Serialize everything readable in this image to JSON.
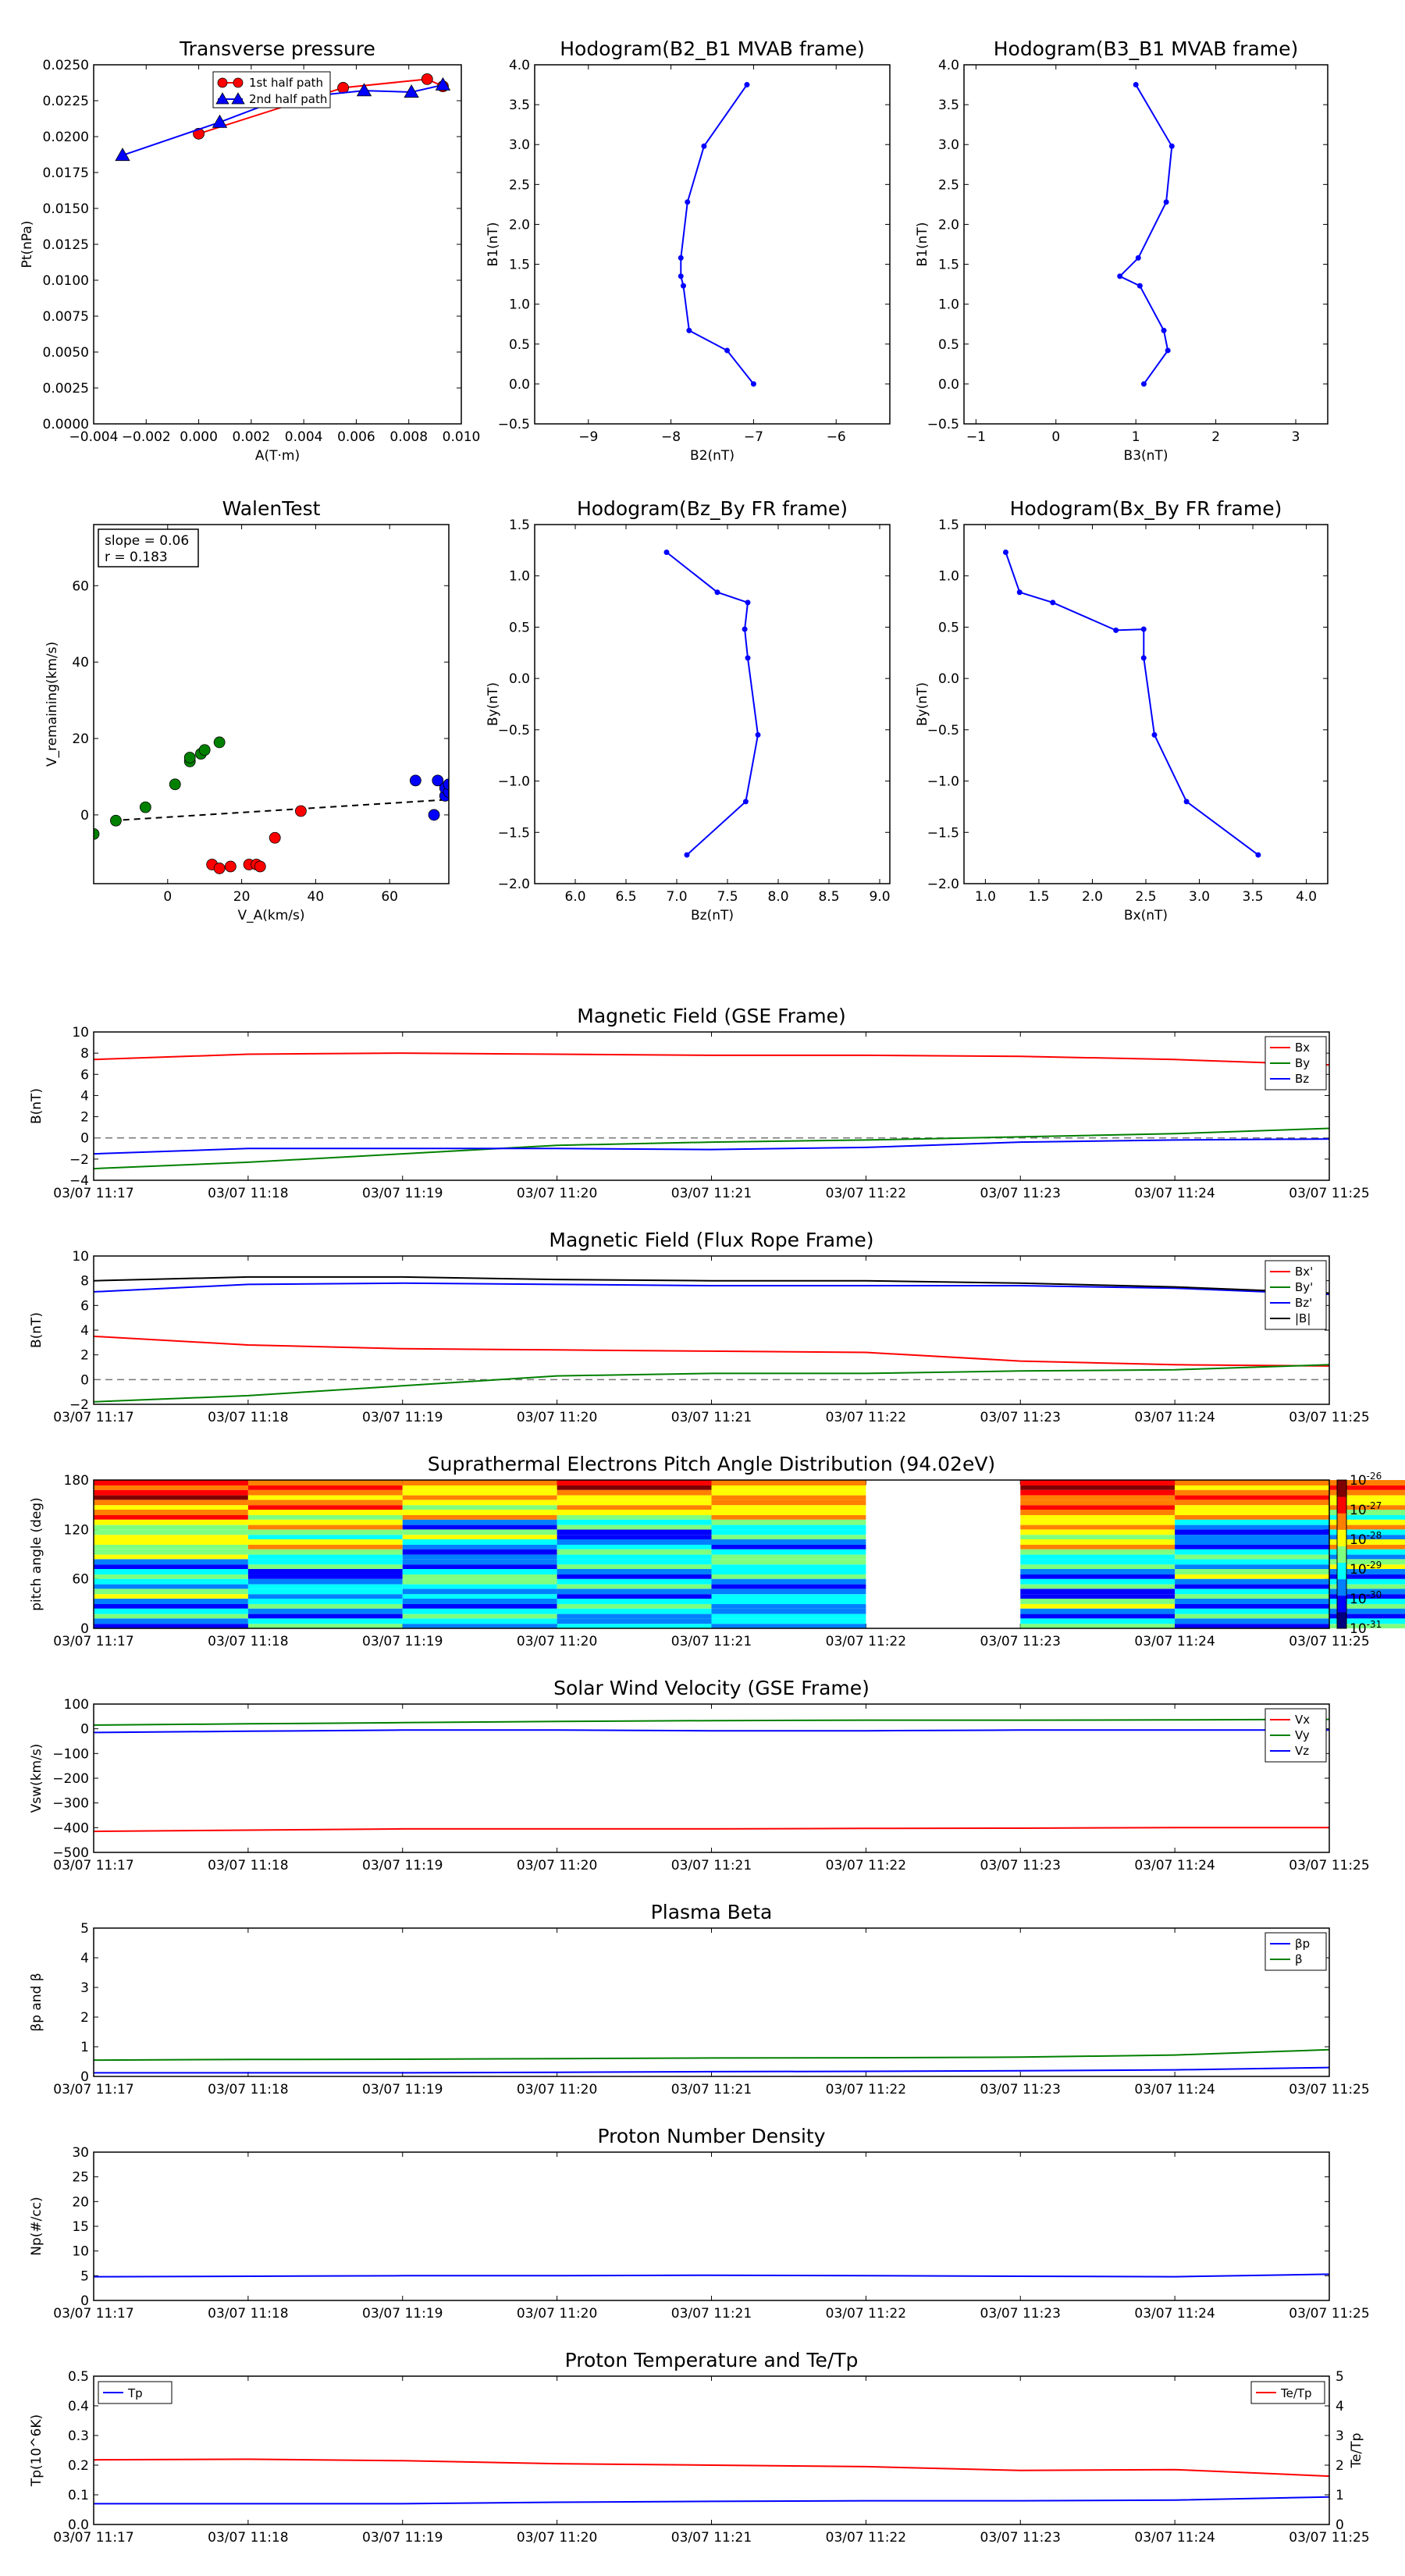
{
  "chart_data": [
    {
      "id": "transverse-pressure",
      "type": "line",
      "title": "Transverse pressure",
      "xlabel": "A(T·m)",
      "ylabel": "Pt(nPa)",
      "xlim": [
        -0.004,
        0.01
      ],
      "ylim": [
        0,
        0.025
      ],
      "xticks": [
        "−0.004",
        "−0.002",
        "0.000",
        "0.002",
        "0.004",
        "0.006",
        "0.008",
        "0.010"
      ],
      "yticks": [
        "0.0000",
        "0.0025",
        "0.0050",
        "0.0075",
        "0.0100",
        "0.0125",
        "0.0150",
        "0.0175",
        "0.0200",
        "0.0225",
        "0.0250"
      ],
      "legend": "top-center",
      "series": [
        {
          "name": "1st half path",
          "color": "#ff0000",
          "marker": "circle",
          "x": [
            0.0,
            0.0055,
            0.0087,
            0.0093
          ],
          "y": [
            0.0202,
            0.0234,
            0.024,
            0.0235
          ]
        },
        {
          "name": "2nd half path",
          "color": "#0000ff",
          "marker": "triangle",
          "x": [
            -0.0029,
            0.0008,
            0.0031,
            0.0063,
            0.0081,
            0.0093
          ],
          "y": [
            0.0187,
            0.021,
            0.0226,
            0.0232,
            0.0231,
            0.0236
          ]
        }
      ]
    },
    {
      "id": "hodogram-b2-b1",
      "type": "line",
      "title": "Hodogram(B2_B1 MVAB frame)",
      "xlabel": "B2(nT)",
      "ylabel": "B1(nT)",
      "xlim": [
        -9.65,
        -5.35
      ],
      "ylim": [
        -0.5,
        4.0
      ],
      "xticks": [
        "−9",
        "−8",
        "−7",
        "−6"
      ],
      "yticks": [
        "−0.5",
        "0.0",
        "0.5",
        "1.0",
        "1.5",
        "2.0",
        "2.5",
        "3.0",
        "3.5",
        "4.0"
      ],
      "series": [
        {
          "color": "#0000ff",
          "x": [
            -7.0,
            -7.32,
            -7.78,
            -7.85,
            -7.88,
            -7.88,
            -7.8,
            -7.6,
            -7.08
          ],
          "y": [
            0.0,
            0.42,
            0.67,
            1.23,
            1.35,
            1.58,
            2.28,
            2.98,
            3.75
          ]
        }
      ]
    },
    {
      "id": "hodogram-b3-b1",
      "type": "line",
      "title": "Hodogram(B3_B1 MVAB frame)",
      "xlabel": "B3(nT)",
      "ylabel": "B1(nT)",
      "xlim": [
        -1.15,
        3.4
      ],
      "ylim": [
        -0.5,
        4.0
      ],
      "xticks": [
        "−1",
        "0",
        "1",
        "2",
        "3"
      ],
      "yticks": [
        "−0.5",
        "0.0",
        "0.5",
        "1.0",
        "1.5",
        "2.0",
        "2.5",
        "3.0",
        "3.5",
        "4.0"
      ],
      "series": [
        {
          "color": "#0000ff",
          "x": [
            1.1,
            1.4,
            1.35,
            1.05,
            0.8,
            1.03,
            1.38,
            1.45,
            1.0
          ],
          "y": [
            0.0,
            0.42,
            0.67,
            1.23,
            1.35,
            1.58,
            2.28,
            2.98,
            3.75
          ]
        }
      ]
    },
    {
      "id": "walen-test",
      "type": "scatter",
      "title": "WalenTest",
      "xlabel": "V_A(km/s)",
      "ylabel": "V_remaining(km/s)",
      "xlim": [
        -20,
        76
      ],
      "ylim": [
        -18,
        76
      ],
      "xticks": [
        "0",
        "20",
        "40",
        "60"
      ],
      "yticks": [
        "0",
        "20",
        "40",
        "60"
      ],
      "annotation": [
        "slope = 0.06",
        "r = 0.183"
      ],
      "fit_line": {
        "x": [
          -15,
          76
        ],
        "y": [
          -1.5,
          4.0
        ],
        "color": "#000000"
      },
      "series": [
        {
          "color": "#008000",
          "x": [
            -20,
            -14,
            -6,
            2,
            6,
            6,
            9,
            10,
            14
          ],
          "y": [
            -5,
            -1.5,
            2,
            8,
            14,
            15,
            16,
            17,
            19
          ]
        },
        {
          "color": "#ff0000",
          "x": [
            12,
            14,
            17,
            22,
            24,
            25,
            29,
            36
          ],
          "y": [
            -13,
            -14,
            -13.5,
            -13,
            -13,
            -13.5,
            -6,
            1
          ]
        },
        {
          "color": "#0000ff",
          "x": [
            67,
            72,
            73,
            75,
            75,
            76,
            76
          ],
          "y": [
            9,
            0,
            9,
            5,
            7,
            6,
            8
          ]
        }
      ]
    },
    {
      "id": "hodogram-bz-by",
      "type": "line",
      "title": "Hodogram(Bz_By FR frame)",
      "xlabel": "Bz(nT)",
      "ylabel": "By(nT)",
      "xlim": [
        5.6,
        9.1
      ],
      "ylim": [
        -2.0,
        1.5
      ],
      "xticks": [
        "6.0",
        "6.5",
        "7.0",
        "7.5",
        "8.0",
        "8.5",
        "9.0"
      ],
      "yticks": [
        "−2.0",
        "−1.5",
        "−1.0",
        "−0.5",
        "0.0",
        "0.5",
        "1.0",
        "1.5"
      ],
      "series": [
        {
          "color": "#0000ff",
          "x": [
            7.1,
            7.68,
            7.8,
            7.7,
            7.67,
            7.7,
            7.4,
            6.9
          ],
          "y": [
            -1.72,
            -1.2,
            -0.55,
            0.2,
            0.48,
            0.74,
            0.84,
            1.23
          ]
        }
      ]
    },
    {
      "id": "hodogram-bx-by",
      "type": "line",
      "title": "Hodogram(Bx_By FR frame)",
      "xlabel": "Bx(nT)",
      "ylabel": "By(nT)",
      "xlim": [
        0.8,
        4.2
      ],
      "ylim": [
        -2.0,
        1.5
      ],
      "xticks": [
        "1.0",
        "1.5",
        "2.0",
        "2.5",
        "3.0",
        "3.5",
        "4.0"
      ],
      "yticks": [
        "−2.0",
        "−1.5",
        "−1.0",
        "−0.5",
        "0.0",
        "0.5",
        "1.0",
        "1.5"
      ],
      "series": [
        {
          "color": "#0000ff",
          "x": [
            3.55,
            2.88,
            2.58,
            2.48,
            2.48,
            2.22,
            1.63,
            1.32,
            1.19
          ],
          "y": [
            -1.72,
            -1.2,
            -0.55,
            0.2,
            0.48,
            0.47,
            0.74,
            0.84,
            1.23
          ]
        }
      ]
    },
    {
      "id": "magnetic-field-gse",
      "type": "line",
      "title": "Magnetic Field (GSE Frame)",
      "ylabel": "B(nT)",
      "x": [
        "03/07 11:17",
        "03/07 11:18",
        "03/07 11:19",
        "03/07 11:20",
        "03/07 11:21",
        "03/07 11:22",
        "03/07 11:23",
        "03/07 11:24",
        "03/07 11:25"
      ],
      "ylim": [
        -4,
        10
      ],
      "yticks": [
        "−4",
        "−2",
        "0",
        "2",
        "4",
        "6",
        "8",
        "10"
      ],
      "zero_line": true,
      "legend": "top-right",
      "series": [
        {
          "name": "Bx",
          "color": "#ff0000",
          "values": [
            7.4,
            7.9,
            8.0,
            7.9,
            7.8,
            7.8,
            7.7,
            7.4,
            6.9
          ]
        },
        {
          "name": "By",
          "color": "#008000",
          "values": [
            -2.9,
            -2.3,
            -1.5,
            -0.7,
            -0.4,
            -0.2,
            0.1,
            0.4,
            0.9
          ]
        },
        {
          "name": "Bz",
          "color": "#0000ff",
          "values": [
            -1.5,
            -1.0,
            -1.0,
            -1.0,
            -1.1,
            -0.9,
            -0.4,
            -0.2,
            -0.1
          ]
        }
      ]
    },
    {
      "id": "magnetic-field-flux-rope",
      "type": "line",
      "title": "Magnetic Field (Flux Rope Frame)",
      "ylabel": "B(nT)",
      "x": [
        "03/07 11:17",
        "03/07 11:18",
        "03/07 11:19",
        "03/07 11:20",
        "03/07 11:21",
        "03/07 11:22",
        "03/07 11:23",
        "03/07 11:24",
        "03/07 11:25"
      ],
      "ylim": [
        -2,
        10
      ],
      "yticks": [
        "−2",
        "0",
        "2",
        "4",
        "6",
        "8",
        "10"
      ],
      "zero_line": true,
      "legend": "top-right",
      "series": [
        {
          "name": "Bx'",
          "color": "#ff0000",
          "values": [
            3.5,
            2.8,
            2.5,
            2.4,
            2.3,
            2.2,
            1.5,
            1.2,
            1.1
          ]
        },
        {
          "name": "By'",
          "color": "#008000",
          "values": [
            -1.8,
            -1.3,
            -0.5,
            0.3,
            0.5,
            0.5,
            0.7,
            0.8,
            1.2
          ]
        },
        {
          "name": "Bz'",
          "color": "#0000ff",
          "values": [
            7.1,
            7.7,
            7.8,
            7.7,
            7.6,
            7.6,
            7.6,
            7.4,
            6.9
          ]
        },
        {
          "name": "|B|",
          "color": "#000000",
          "values": [
            8.0,
            8.3,
            8.3,
            8.1,
            8.0,
            8.0,
            7.8,
            7.5,
            7.0
          ]
        }
      ]
    },
    {
      "id": "pitch-angle-distribution",
      "type": "heatmap",
      "title": "Suprathermal Electrons Pitch Angle Distribution (94.02eV)",
      "ylabel": "pitch angle (deg)",
      "x": [
        "03/07 11:17",
        "03/07 11:18",
        "03/07 11:19",
        "03/07 11:20",
        "03/07 11:21",
        "03/07 11:22",
        "03/07 11:23",
        "03/07 11:24",
        "03/07 11:25"
      ],
      "ylim": [
        0,
        180
      ],
      "yticks": [
        "0",
        "60",
        "120",
        "180"
      ],
      "colorbar": {
        "ticks": [
          "10-31",
          "10-30",
          "10-29",
          "10-28",
          "10-27",
          "10-26"
        ],
        "colors": [
          "#00007f",
          "#0000ff",
          "#007fff",
          "#00ffff",
          "#7fff7f",
          "#ffff00",
          "#ff7f00",
          "#ff0000",
          "#7f0000"
        ]
      },
      "empty_columns": [
        5
      ],
      "bins_per_column": 15,
      "pattern": [
        [
          2,
          3,
          2,
          4,
          3,
          3,
          2,
          4,
          5,
          4,
          5,
          6,
          6,
          7,
          7
        ],
        [
          3,
          2,
          3,
          3,
          2,
          1,
          3,
          4,
          5,
          4,
          5,
          5,
          6,
          6,
          6
        ],
        [
          3,
          3,
          2,
          2,
          4,
          3,
          2,
          1,
          3,
          4,
          2,
          5,
          5,
          5,
          6
        ],
        [
          2,
          3,
          3,
          2,
          3,
          2,
          3,
          4,
          2,
          1,
          3,
          5,
          5,
          6,
          7
        ],
        [
          3,
          2,
          3,
          2,
          2,
          3,
          4,
          3,
          2,
          3,
          4,
          5,
          6,
          5,
          6
        ],
        [
          3,
          2,
          4,
          1,
          3,
          2,
          3,
          4,
          5,
          5,
          5,
          6,
          6,
          7,
          7
        ],
        [
          2,
          3,
          2,
          3,
          2,
          4,
          3,
          3,
          2,
          1,
          3,
          5,
          6,
          6,
          6
        ],
        [
          3,
          2,
          3,
          2,
          3,
          2,
          4,
          3,
          5,
          3,
          5,
          4,
          5,
          6,
          6
        ]
      ]
    },
    {
      "id": "solar-wind-velocity",
      "type": "line",
      "title": "Solar Wind Velocity (GSE Frame)",
      "ylabel": "Vsw(km/s)",
      "x": [
        "03/07 11:17",
        "03/07 11:18",
        "03/07 11:19",
        "03/07 11:20",
        "03/07 11:21",
        "03/07 11:22",
        "03/07 11:23",
        "03/07 11:24",
        "03/07 11:25"
      ],
      "ylim": [
        -500,
        100
      ],
      "yticks": [
        "−500",
        "−400",
        "−300",
        "−200",
        "−100",
        "0",
        "100"
      ],
      "legend": "top-right",
      "series": [
        {
          "name": "Vx",
          "color": "#ff0000",
          "values": [
            -415,
            -410,
            -405,
            -405,
            -405,
            -403,
            -402,
            -400,
            -400
          ]
        },
        {
          "name": "Vy",
          "color": "#008000",
          "values": [
            15,
            20,
            25,
            30,
            33,
            35,
            35,
            36,
            38
          ]
        },
        {
          "name": "Vz",
          "color": "#0000ff",
          "values": [
            -15,
            -10,
            -5,
            -5,
            -8,
            -8,
            -5,
            -5,
            -5
          ]
        }
      ]
    },
    {
      "id": "plasma-beta",
      "type": "line",
      "title": "Plasma Beta",
      "ylabel": "βp and β",
      "x": [
        "03/07 11:17",
        "03/07 11:18",
        "03/07 11:19",
        "03/07 11:20",
        "03/07 11:21",
        "03/07 11:22",
        "03/07 11:23",
        "03/07 11:24",
        "03/07 11:25"
      ],
      "ylim": [
        0,
        5
      ],
      "yticks": [
        "0",
        "1",
        "2",
        "3",
        "4",
        "5"
      ],
      "legend": "top-right",
      "series": [
        {
          "name": "βp",
          "color": "#0000ff",
          "values": [
            0.12,
            0.12,
            0.12,
            0.14,
            0.16,
            0.17,
            0.19,
            0.22,
            0.3
          ]
        },
        {
          "name": "β",
          "color": "#008000",
          "values": [
            0.55,
            0.57,
            0.58,
            0.6,
            0.62,
            0.63,
            0.65,
            0.72,
            0.9
          ]
        }
      ]
    },
    {
      "id": "proton-number-density",
      "type": "line",
      "title": "Proton Number Density",
      "ylabel": "Np(#/cc)",
      "x": [
        "03/07 11:17",
        "03/07 11:18",
        "03/07 11:19",
        "03/07 11:20",
        "03/07 11:21",
        "03/07 11:22",
        "03/07 11:23",
        "03/07 11:24",
        "03/07 11:25"
      ],
      "ylim": [
        0,
        30
      ],
      "yticks": [
        "0",
        "5",
        "10",
        "15",
        "20",
        "25",
        "30"
      ],
      "series": [
        {
          "color": "#0000ff",
          "values": [
            4.8,
            4.9,
            5.0,
            5.0,
            5.1,
            5.0,
            4.9,
            4.8,
            5.3
          ]
        }
      ]
    },
    {
      "id": "proton-temperature",
      "type": "line",
      "title": "Proton Temperature and Te/Tp",
      "ylabel": "Tp(10^6K)",
      "ylabel_right": "Te/Tp",
      "x": [
        "03/07 11:17",
        "03/07 11:18",
        "03/07 11:19",
        "03/07 11:20",
        "03/07 11:21",
        "03/07 11:22",
        "03/07 11:23",
        "03/07 11:24",
        "03/07 11:25"
      ],
      "ylim": [
        0,
        0.5
      ],
      "yticks": [
        "0.0",
        "0.1",
        "0.2",
        "0.3",
        "0.4",
        "0.5"
      ],
      "ylim_right": [
        0,
        5
      ],
      "yticks_right": [
        "0",
        "1",
        "2",
        "3",
        "4",
        "5"
      ],
      "series": [
        {
          "name": "Tp",
          "axis": "left",
          "color": "#0000ff",
          "values": [
            0.07,
            0.07,
            0.07,
            0.075,
            0.078,
            0.08,
            0.08,
            0.082,
            0.093
          ]
        },
        {
          "name": "Te/Tp",
          "axis": "right",
          "color": "#ff0000",
          "values": [
            2.18,
            2.2,
            2.15,
            2.05,
            2.0,
            1.95,
            1.82,
            1.85,
            1.63
          ]
        }
      ]
    }
  ]
}
